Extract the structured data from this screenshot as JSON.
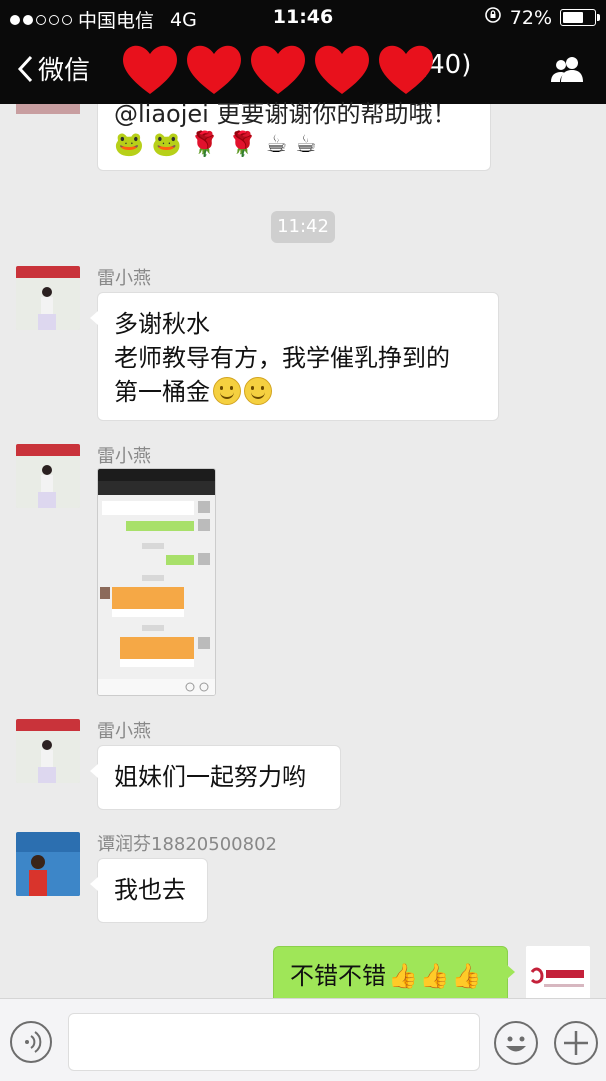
{
  "status_bar": {
    "carrier": "中国电信",
    "network": "4G",
    "time": "11:46",
    "battery": "72%",
    "battery_level": 0.72
  },
  "nav": {
    "back_label": "微信",
    "title_visible": "(40)"
  },
  "top_message": {
    "text": "@liaojei 更要谢谢你的帮助哦！",
    "emojis": [
      "🐸",
      "🐸",
      "🌹",
      "🌹",
      "☕",
      "☕"
    ]
  },
  "timestamp": "11:42",
  "messages": [
    {
      "sender": "雷小燕",
      "lines": [
        "多谢秋水",
        "老师教导有方，我学催乳挣到的",
        "第一桶金"
      ],
      "trailing_emojis": [
        "smile-emoji",
        "smile-emoji"
      ]
    },
    {
      "sender": "雷小燕",
      "type": "image"
    },
    {
      "sender": "雷小燕",
      "lines": [
        "姐妹们一起努力哟"
      ]
    },
    {
      "sender": "谭润芬18820500802",
      "lines": [
        "我也去"
      ]
    },
    {
      "sender": "self",
      "lines": [
        "不错不错"
      ],
      "trailing_emojis": [
        "thumbs-up-icon",
        "thumbs-up-icon",
        "thumbs-up-icon"
      ]
    }
  ],
  "colors": {
    "navbar": "#0a0a0a",
    "background": "#ebebeb",
    "self_bubble": "#9fe658"
  }
}
